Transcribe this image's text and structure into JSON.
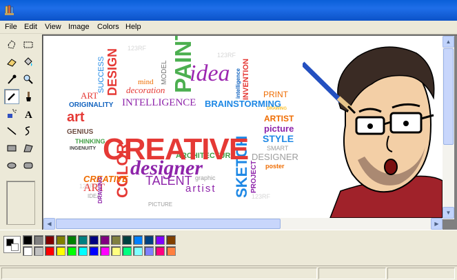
{
  "menubar": {
    "items": [
      "File",
      "Edit",
      "View",
      "Image",
      "Colors",
      "Help"
    ]
  },
  "toolbox": {
    "tools": [
      "free-form-select",
      "select",
      "eraser",
      "fill-with-color",
      "pick-color",
      "magnifier",
      "pencil",
      "brush",
      "airbrush",
      "text",
      "line",
      "curve",
      "rectangle",
      "polygon",
      "ellipse",
      "rounded-rectangle"
    ],
    "active_tool": "pencil"
  },
  "palette": {
    "foreground": "#000000",
    "background": "#ffffff",
    "top_row": [
      "#000000",
      "#808080",
      "#800000",
      "#808000",
      "#008000",
      "#008080",
      "#000080",
      "#800080",
      "#808040",
      "#004040",
      "#0080ff",
      "#004080",
      "#8000ff",
      "#804000"
    ],
    "bottom_row": [
      "#ffffff",
      "#c0c0c0",
      "#ff0000",
      "#ffff00",
      "#00ff00",
      "#00ffff",
      "#0000ff",
      "#ff00ff",
      "#ffff80",
      "#00ff80",
      "#80ffff",
      "#8080ff",
      "#ff0080",
      "#ff8040"
    ]
  },
  "canvas": {
    "wordcloud": {
      "headline": "CREATIVE",
      "subheadline": "designer",
      "words": [
        {
          "text": "PAINT",
          "color": "#4caf50"
        },
        {
          "text": "idea",
          "color": "#9c27b0"
        },
        {
          "text": "BRAINSTORMING",
          "color": "#1e88e5"
        },
        {
          "text": "INTELLIGENCE",
          "color": "#8e24aa"
        },
        {
          "text": "DESIGN",
          "color": "#e53935"
        },
        {
          "text": "SUCCESS",
          "color": "#1e88e5"
        },
        {
          "text": "PRINT",
          "color": "#ef6c00"
        },
        {
          "text": "ART",
          "color": "#e53935"
        },
        {
          "text": "ORIGINALITY",
          "color": "#1565c0"
        },
        {
          "text": "GENIUS",
          "color": "#6d4c41"
        },
        {
          "text": "THINKING",
          "color": "#43a047"
        },
        {
          "text": "INGENUITY",
          "color": "#424242"
        },
        {
          "text": "ARCHITECTURE",
          "color": "#43a047"
        },
        {
          "text": "COLOR",
          "color": "#e53935"
        },
        {
          "text": "TALENT",
          "color": "#8e24aa"
        },
        {
          "text": "SKETCH",
          "color": "#1e88e5"
        },
        {
          "text": "STYLE",
          "color": "#1e88e5"
        },
        {
          "text": "ARTIST",
          "color": "#ef6c00"
        },
        {
          "text": "picture",
          "color": "#8e24aa"
        },
        {
          "text": "SMART",
          "color": "#9e9e9e"
        },
        {
          "text": "DESIGNER",
          "color": "#9e9e9e"
        },
        {
          "text": "poster",
          "color": "#ef6c00"
        },
        {
          "text": "PROJECT",
          "color": "#8e24aa"
        },
        {
          "text": "artist",
          "color": "#8e24aa"
        },
        {
          "text": "graphic",
          "color": "#9e9e9e"
        },
        {
          "text": "INVENTION",
          "color": "#e53935"
        },
        {
          "text": "intelligence",
          "color": "#1565c0"
        },
        {
          "text": "CREATIVE",
          "color": "#ef6c00"
        },
        {
          "text": "MODEL",
          "color": "#757575"
        },
        {
          "text": "decoration",
          "color": "#e53935"
        },
        {
          "text": "mind",
          "color": "#ef6c00"
        },
        {
          "text": "DRAWING",
          "color": "#8e24aa"
        },
        {
          "text": "DRAWING",
          "color": "#fbc02d"
        },
        {
          "text": "PICTURE",
          "color": "#9e9e9e"
        },
        {
          "text": "IDEA",
          "color": "#9e9e9e"
        },
        {
          "text": "art",
          "color": "#e53935"
        },
        {
          "text": "ART",
          "color": "#43a047"
        }
      ],
      "watermarks": [
        "123RF",
        "123RF",
        "123RF",
        "123RF"
      ]
    }
  }
}
